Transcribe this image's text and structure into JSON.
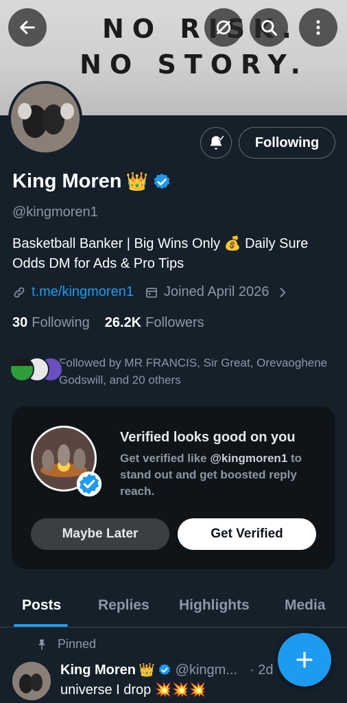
{
  "banner": {
    "line1": "NO RISK.",
    "line2": "NO STORY."
  },
  "icons": {
    "back": "arrow-left-icon",
    "topic": "circle-slash-icon",
    "search": "search-icon",
    "more": "more-vertical-icon",
    "bell": "bell-check-icon",
    "link": "link-icon",
    "calendar": "calendar-icon",
    "chevron": "chevron-right-icon",
    "pin": "pin-icon",
    "compose": "plus-icon"
  },
  "profile": {
    "follow_state": "Following",
    "name": "King Moren",
    "crown": "👑",
    "handle": "@kingmoren1",
    "bio": "Basketball Banker | Big Wins Only 💰 Daily Sure Odds  DM for Ads & Pro Tips",
    "link": "t.me/kingmoren1",
    "joined": "Joined April 2026",
    "following_count": "30",
    "following_label": "Following",
    "followers_count": "26.2K",
    "followers_label": "Followers",
    "followed_by": "Followed by MR FRANCIS, Sir Great, Orevaoghene Godswill, and 20 others"
  },
  "verify_card": {
    "title": "Verified looks good on you",
    "desc_prefix": "Get verified like ",
    "desc_handle": "@kingmoren1",
    "desc_suffix": " to stand out and get boosted reply reach.",
    "maybe_label": "Maybe Later",
    "get_label": "Get Verified"
  },
  "tabs": [
    {
      "label": "Posts",
      "active": true
    },
    {
      "label": "Replies",
      "active": false
    },
    {
      "label": "Highlights",
      "active": false
    },
    {
      "label": "Media",
      "active": false
    }
  ],
  "pinned_post": {
    "pinned_label": "Pinned",
    "name": "King Moren",
    "crown": "👑",
    "handle": "@kingm...",
    "time": "· 2d",
    "text": "universe I drop 💥💥💥"
  },
  "colors": {
    "background": "#15202b",
    "accent": "#1d9bf0",
    "muted_text": "#8b98a5",
    "card_bg": "#0f1419"
  }
}
